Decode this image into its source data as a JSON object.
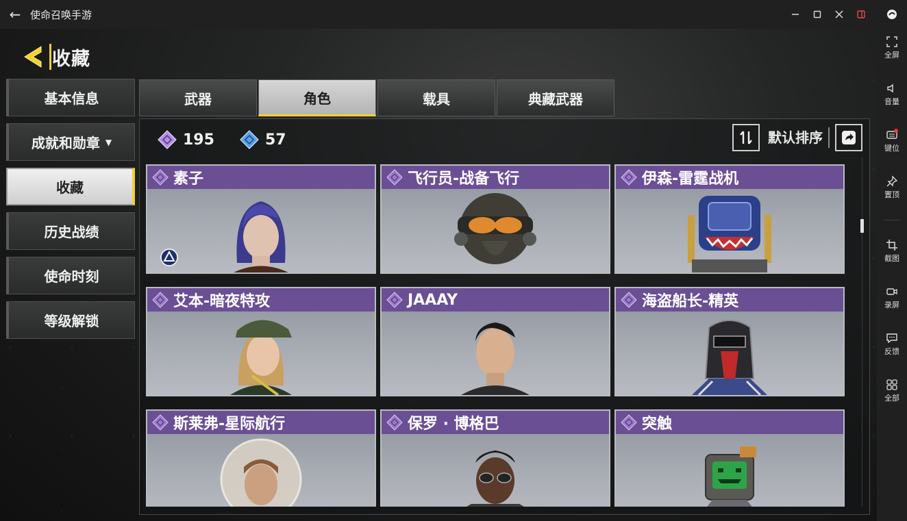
{
  "window": {
    "title": "使命召唤手游"
  },
  "emulator_sidebar": {
    "items": [
      {
        "label": "全屏",
        "icon": "fullscreen-icon"
      },
      {
        "label": "音量",
        "icon": "volume-icon"
      },
      {
        "label": "键位",
        "icon": "keymap-icon"
      },
      {
        "label": "置顶",
        "icon": "pin-icon"
      },
      {
        "label": "截图",
        "icon": "crop-icon"
      },
      {
        "label": "录屏",
        "icon": "record-icon"
      },
      {
        "label": "反馈",
        "icon": "feedback-icon"
      },
      {
        "label": "全部",
        "icon": "grid-icon"
      }
    ]
  },
  "header": {
    "title": "收藏"
  },
  "left_menu": {
    "items": [
      {
        "label": "基本信息",
        "active": false
      },
      {
        "label": "成就和勋章",
        "active": false,
        "has_dropdown": true
      },
      {
        "label": "收藏",
        "active": true
      },
      {
        "label": "历史战绩",
        "active": false
      },
      {
        "label": "使命时刻",
        "active": false
      },
      {
        "label": "等级解锁",
        "active": false
      }
    ]
  },
  "tabs": [
    {
      "label": "武器",
      "active": false
    },
    {
      "label": "角色",
      "active": true
    },
    {
      "label": "载具",
      "active": false
    },
    {
      "label": "典藏武器",
      "active": false
    }
  ],
  "stats": {
    "purple_count": "195",
    "blue_count": "57"
  },
  "sort": {
    "label": "默认排序"
  },
  "characters": [
    {
      "name": "素子",
      "rarity": "epic"
    },
    {
      "name": "飞行员-战备飞行",
      "rarity": "epic"
    },
    {
      "name": "伊森-雷霆战机",
      "rarity": "epic"
    },
    {
      "name": "艾本-暗夜特攻",
      "rarity": "epic"
    },
    {
      "name": "JAAAY",
      "rarity": "epic"
    },
    {
      "name": "海盗船长-精英",
      "rarity": "epic"
    },
    {
      "name": "斯莱弗-星际航行",
      "rarity": "epic"
    },
    {
      "name": "保罗 · 博格巴",
      "rarity": "epic"
    },
    {
      "name": "突触",
      "rarity": "epic"
    }
  ],
  "colors": {
    "accent_yellow": "#f3d22a",
    "card_header_purple": "#6b4f95",
    "epic_diamond": "#b48ee0",
    "rare_diamond": "#5aa0e8"
  }
}
